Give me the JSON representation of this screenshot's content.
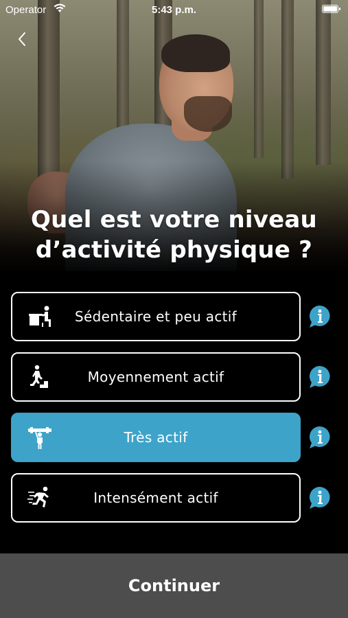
{
  "status_bar": {
    "carrier": "Operator",
    "time": "5:43 p.m."
  },
  "header": {
    "title_line1": "Quel est votre niveau",
    "title_line2": "d’activité physique ?"
  },
  "options": [
    {
      "label": "Sédentaire et peu actif",
      "icon": "desk-sitting-icon",
      "selected": false
    },
    {
      "label": "Moyennement actif",
      "icon": "stairs-climbing-icon",
      "selected": false
    },
    {
      "label": "Très actif",
      "icon": "lifting-icon",
      "selected": true
    },
    {
      "label": "Intensément actif",
      "icon": "running-icon",
      "selected": false
    }
  ],
  "footer": {
    "continue_label": "Continuer"
  },
  "colors": {
    "accent": "#3ea3c9",
    "info": "#3ea3c9",
    "background": "#000000",
    "continue_bg": "#4d4d4d"
  }
}
